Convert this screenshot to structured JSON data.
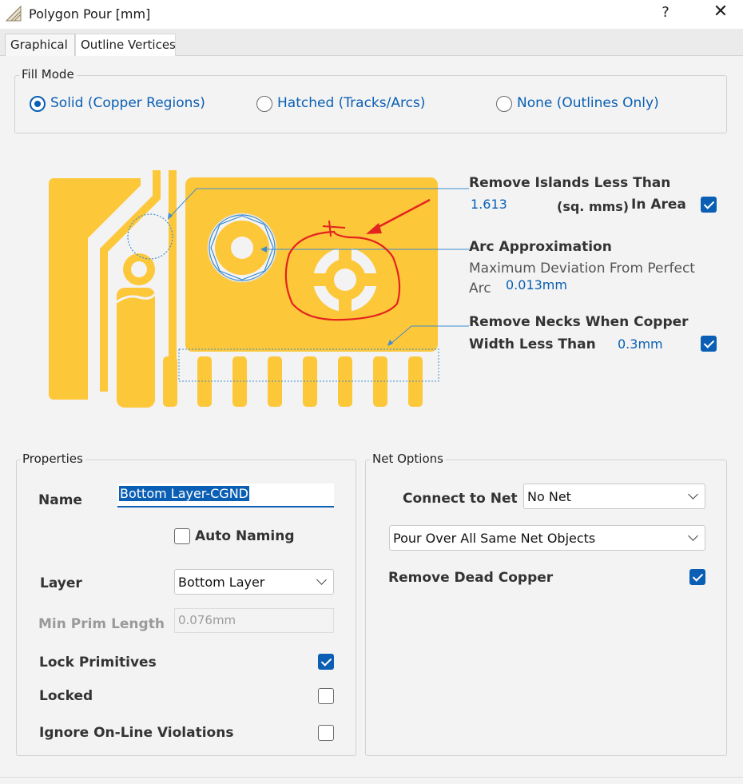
{
  "window": {
    "title": "Polygon Pour [mm]",
    "help": "?",
    "close": "✕"
  },
  "tabs": [
    {
      "label": "Graphical",
      "active": true
    },
    {
      "label": "Outline Vertices",
      "active": false
    }
  ],
  "fill_mode": {
    "legend": "Fill Mode",
    "options": [
      {
        "label": "Solid (Copper Regions)",
        "selected": true
      },
      {
        "label": "Hatched (Tracks/Arcs)",
        "selected": false
      },
      {
        "label": "None (Outlines Only)",
        "selected": false
      }
    ]
  },
  "graphic": {
    "remove_islands": {
      "label": "Remove Islands Less Than",
      "value": "1.613",
      "unit": "(sq. mms)",
      "suffix": "In Area",
      "checked": true
    },
    "arc_approx": {
      "label": "Arc Approximation",
      "desc_line1": "Maximum Deviation From Perfect",
      "desc_line2": "Arc",
      "value": "0.013mm"
    },
    "remove_necks": {
      "label_line1": "Remove Necks When Copper",
      "label_line2": "Width Less Than",
      "value": "0.3mm",
      "checked": true
    }
  },
  "properties": {
    "legend": "Properties",
    "name_label": "Name",
    "name_value": "Bottom Layer-CGND",
    "auto_naming": {
      "label": "Auto Naming",
      "checked": false
    },
    "layer_label": "Layer",
    "layer_value": "Bottom Layer",
    "min_prim_label": "Min Prim Length",
    "min_prim_value": "0.076mm",
    "lock_primitives": {
      "label": "Lock Primitives",
      "checked": true
    },
    "locked": {
      "label": "Locked",
      "checked": false
    },
    "ignore_online": {
      "label": "Ignore On-Line Violations",
      "checked": false
    }
  },
  "net_options": {
    "legend": "Net Options",
    "connect_label": "Connect to Net",
    "connect_value": "No Net",
    "pour_value": "Pour Over All Same Net Objects",
    "remove_dead": {
      "label": "Remove Dead Copper",
      "checked": true
    }
  },
  "colors": {
    "copper": "#fdc73a",
    "accent": "#0a5fb4",
    "annotation": "#e3231e"
  }
}
